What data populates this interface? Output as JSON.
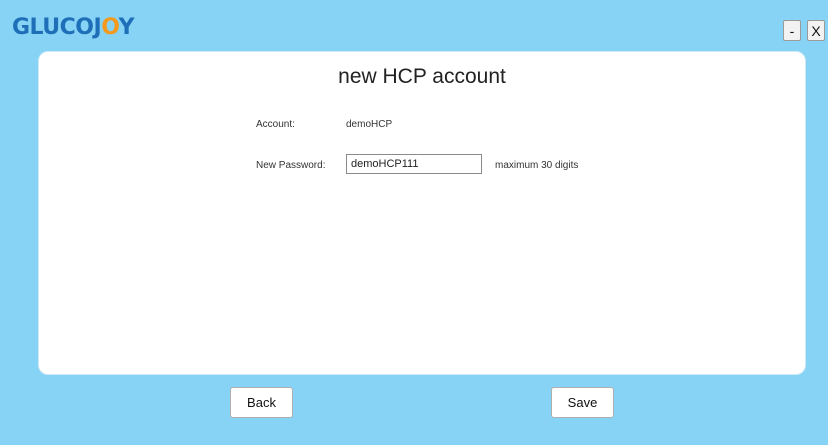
{
  "app": {
    "logo_part1": "GLUCOJ",
    "logo_accent": "O",
    "logo_part2": "Y"
  },
  "window_controls": {
    "minimize_label": "-",
    "close_label": "X"
  },
  "form": {
    "title": "new HCP account",
    "account_label": "Account:",
    "account_value": "demoHCP",
    "password_label": "New Password:",
    "password_value": "demoHCP111",
    "password_hint": "maximum 30 digits"
  },
  "footer": {
    "back_label": "Back",
    "save_label": "Save"
  },
  "colors": {
    "background": "#87D3F5",
    "logo_blue": "#1E6FB8",
    "logo_orange": "#F39A1E",
    "panel": "#FFFFFF"
  }
}
